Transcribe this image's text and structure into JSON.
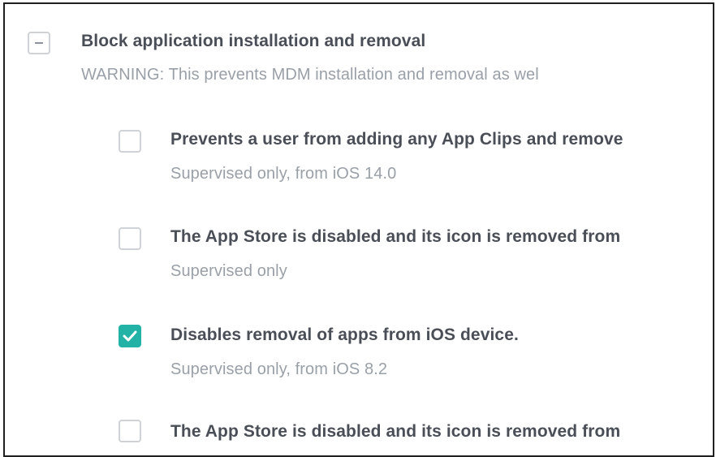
{
  "group": {
    "title": "Block application installation and removal",
    "warning": "WARNING: This prevents MDM installation and removal as wel",
    "state": "indeterminate"
  },
  "options": [
    {
      "label": "Prevents a user from adding any App Clips and remove",
      "note": "Supervised only, from iOS 14.0",
      "checked": false
    },
    {
      "label": "The App Store is disabled and its icon is removed from",
      "note": "Supervised only",
      "checked": false
    },
    {
      "label": "Disables removal of apps from iOS device.",
      "note": "Supervised only, from iOS 8.2",
      "checked": true
    },
    {
      "label": "The App Store is disabled and its icon is removed from",
      "note": "",
      "checked": false
    }
  ],
  "colors": {
    "accent": "#22b3a6",
    "title_text": "#4a4e57",
    "muted_text": "#9aa0a8",
    "checkbox_border": "#cfd2d6"
  }
}
